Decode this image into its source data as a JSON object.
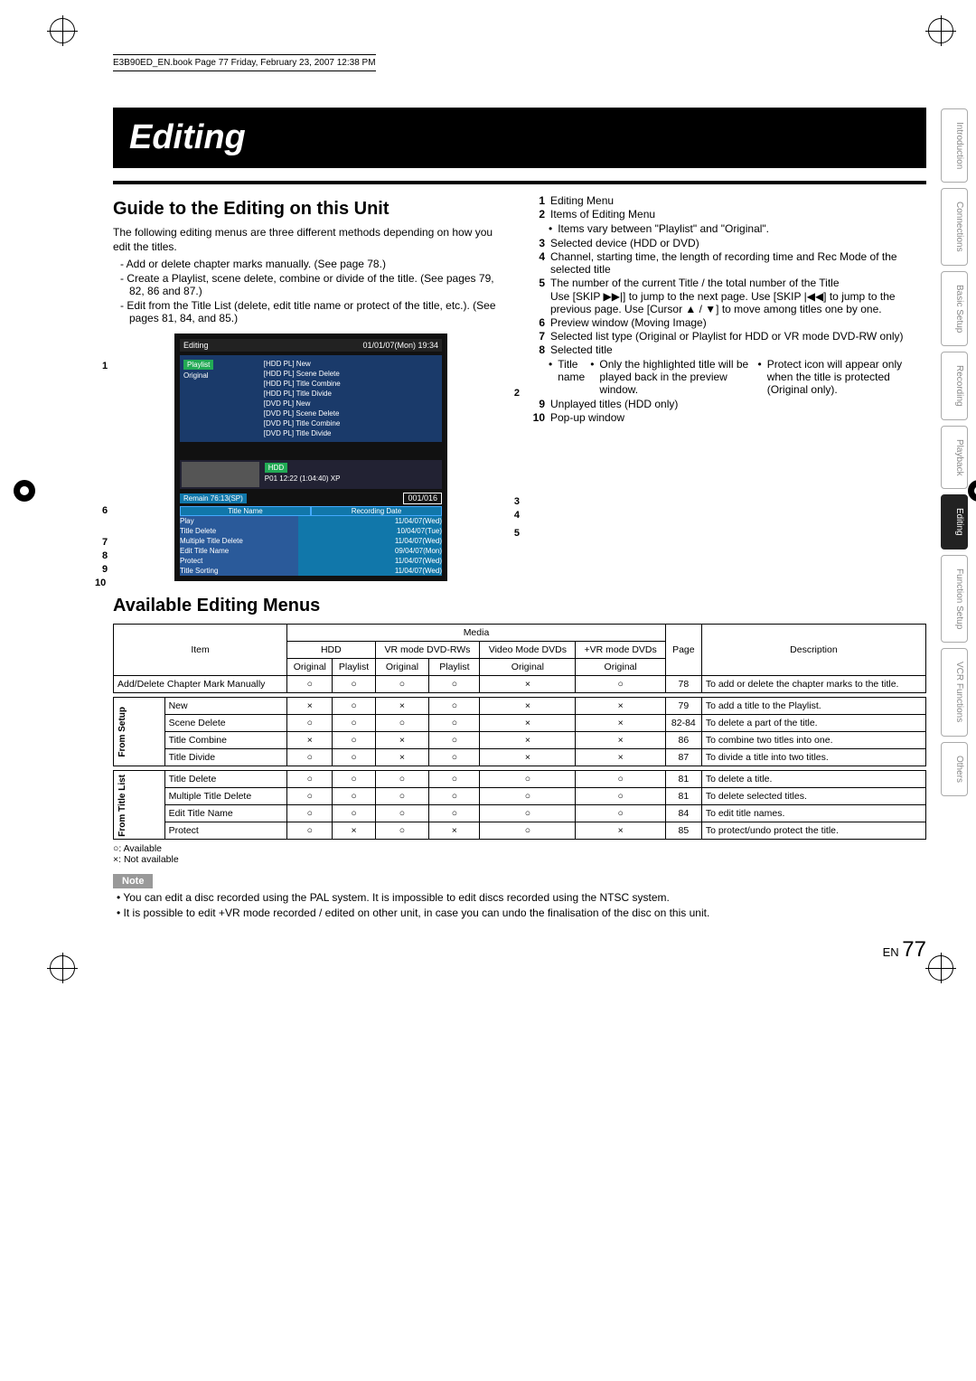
{
  "header_line": "E3B90ED_EN.book  Page 77  Friday, February 23, 2007  12:38 PM",
  "title": "Editing",
  "section1": {
    "heading": "Guide to the Editing on this Unit",
    "intro": "The following editing menus are three different methods depending on how you edit the titles.",
    "dashes": [
      "Add or delete chapter marks manually. (See page 78.)",
      "Create a Playlist, scene delete, combine or divide of the title. (See pages 79, 82, 86 and 87.)",
      "Edit from the Title List (delete, edit title name or protect of the title, etc.). (See pages 81, 84, and 85.)"
    ]
  },
  "screen": {
    "top_left": "Editing",
    "top_right": "01/01/07(Mon)   19:34",
    "left_items": [
      "Playlist",
      "Original"
    ],
    "right_items": [
      "[HDD PL] New",
      "[HDD PL] Scene Delete",
      "[HDD PL] Title Combine",
      "[HDD PL] Title Divide",
      "[DVD PL] New",
      "[DVD PL] Scene Delete",
      "[DVD PL] Title Combine",
      "[DVD PL] Title Divide"
    ],
    "device": "HDD",
    "info": "P01  12:22 (1:04:40) XP",
    "remain": "Remain   76:13(SP)",
    "counter": "001/016",
    "col_a": "Title Name",
    "col_b": "Recording Date",
    "popup": [
      "Play",
      "Title Delete",
      "Multiple Title Delete",
      "Edit Title Name",
      "Protect",
      "Title Sorting"
    ],
    "rows_right": [
      "11/04/07(Wed)",
      "10/04/07(Tue)",
      "11/04/07(Wed)",
      "09/04/07(Mon)",
      "11/04/07(Wed)",
      "11/04/07(Wed)",
      "11/04/07(Wed)",
      "11/04/07(Wed)"
    ]
  },
  "legend_items": [
    {
      "n": "1",
      "t": "Editing Menu"
    },
    {
      "n": "2",
      "t": "Items of Editing Menu",
      "sub": [
        "Items vary between \"Playlist\" and \"Original\"."
      ]
    },
    {
      "n": "3",
      "t": "Selected device (HDD or DVD)"
    },
    {
      "n": "4",
      "t": "Channel, starting time, the length of recording time and Rec Mode of the selected title"
    },
    {
      "n": "5",
      "t": "The number of the current Title / the total number of the Title",
      "extra": "Use [SKIP ▶▶|] to jump to the next page. Use [SKIP |◀◀] to jump to the previous page. Use [Cursor ▲ / ▼] to move among titles one by one."
    },
    {
      "n": "6",
      "t": "Preview window (Moving Image)"
    },
    {
      "n": "7",
      "t": "Selected list type (Original or Playlist for HDD or VR mode DVD-RW only)"
    },
    {
      "n": "8",
      "t": "Selected title",
      "sub": [
        "Title name",
        "Only the highlighted title will be played back in the preview window.",
        "Protect icon will appear only when the title is protected (Original only)."
      ]
    },
    {
      "n": "9",
      "t": "Unplayed titles (HDD only)"
    },
    {
      "n": "10",
      "t": "Pop-up window"
    }
  ],
  "section2_heading": "Available Editing Menus",
  "table": {
    "head_media": "Media",
    "head_item": "Item",
    "head_page": "Page",
    "head_desc": "Description",
    "media_cols": [
      "HDD",
      "VR mode DVD-RWs",
      "Video Mode DVDs",
      "+VR mode DVDs"
    ],
    "sub_cols": [
      "Original",
      "Playlist",
      "Original",
      "Playlist",
      "Original",
      "Original"
    ],
    "group0": {
      "label": "",
      "rows": [
        {
          "item": "Add/Delete Chapter Mark Manually",
          "v": [
            "○",
            "○",
            "○",
            "○",
            "×",
            "○"
          ],
          "page": "78",
          "desc": "To add or delete the chapter marks to the title."
        }
      ]
    },
    "group1": {
      "label": "From Setup",
      "rows": [
        {
          "item": "New",
          "v": [
            "×",
            "○",
            "×",
            "○",
            "×",
            "×"
          ],
          "page": "79",
          "desc": "To add a title to the Playlist."
        },
        {
          "item": "Scene Delete",
          "v": [
            "○",
            "○",
            "○",
            "○",
            "×",
            "×"
          ],
          "page": "82-84",
          "desc": "To delete a part of the title."
        },
        {
          "item": "Title Combine",
          "v": [
            "×",
            "○",
            "×",
            "○",
            "×",
            "×"
          ],
          "page": "86",
          "desc": "To combine two titles into one."
        },
        {
          "item": "Title Divide",
          "v": [
            "○",
            "○",
            "×",
            "○",
            "×",
            "×"
          ],
          "page": "87",
          "desc": "To divide a title into two titles."
        }
      ]
    },
    "group2": {
      "label": "From Title List",
      "rows": [
        {
          "item": "Title Delete",
          "v": [
            "○",
            "○",
            "○",
            "○",
            "○",
            "○"
          ],
          "page": "81",
          "desc": "To delete a title."
        },
        {
          "item": "Multiple Title Delete",
          "v": [
            "○",
            "○",
            "○",
            "○",
            "○",
            "○"
          ],
          "page": "81",
          "desc": "To delete selected titles."
        },
        {
          "item": "Edit Title Name",
          "v": [
            "○",
            "○",
            "○",
            "○",
            "○",
            "○"
          ],
          "page": "84",
          "desc": "To edit title names."
        },
        {
          "item": "Protect",
          "v": [
            "○",
            "×",
            "○",
            "×",
            "○",
            "×"
          ],
          "page": "85",
          "desc": "To protect/undo protect the title."
        }
      ]
    }
  },
  "legend": {
    "a": "○: Available",
    "b": "×: Not available"
  },
  "note_label": "Note",
  "notes": [
    "You can edit a disc recorded using the PAL system. It is impossible to edit discs recorded using the NTSC system.",
    "It is possible to edit +VR mode recorded / edited on other unit, in case you can undo the finalisation of the disc on this unit."
  ],
  "side_tabs": [
    "Introduction",
    "Connections",
    "Basic Setup",
    "Recording",
    "Playback",
    "Editing",
    "Function Setup",
    "VCR Functions",
    "Others"
  ],
  "footer": {
    "lang": "EN",
    "page": "77"
  }
}
